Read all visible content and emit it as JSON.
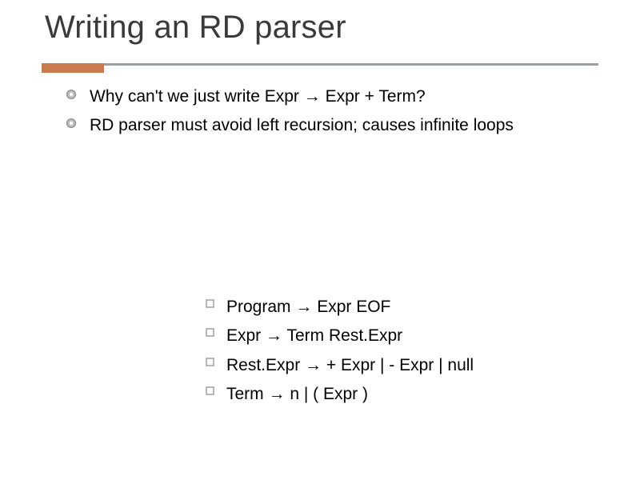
{
  "title": "Writing an RD parser",
  "points": [
    "Why can't we just write  Expr → Expr + Term?",
    "RD parser must avoid left recursion; causes infinite loops"
  ],
  "grammar": [
    "Program → Expr EOF",
    "Expr → Term Rest.Expr",
    "Rest.Expr → + Expr | - Expr | null",
    "Term → n | ( Expr )"
  ],
  "colors": {
    "accent": "#c97b4e",
    "rule": "#9aa19f",
    "bulletFill": "#bfbfbf",
    "bulletStroke": "#8c8c8c",
    "subBulletStroke": "#9a9a9a"
  }
}
